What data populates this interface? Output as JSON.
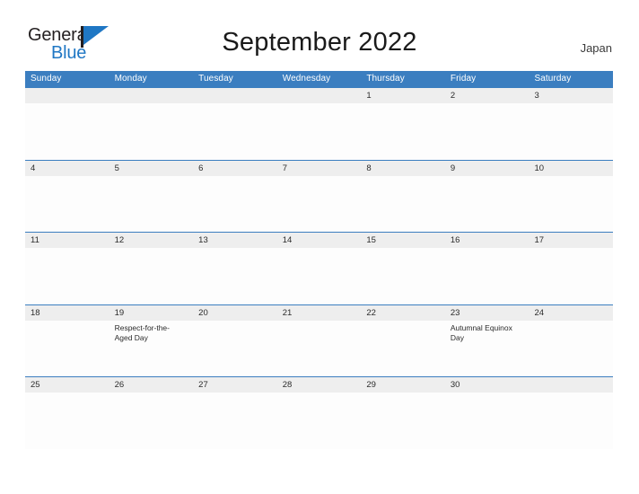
{
  "brand": {
    "name_part1": "General",
    "name_part2": "Blue",
    "flag_icon": "flag-icon",
    "accent_color": "#1f77c4",
    "dark_color": "#231f20"
  },
  "header": {
    "title": "September 2022",
    "region": "Japan"
  },
  "calendar": {
    "header_color": "#3b7ec0",
    "number_strip_color": "#eeeeee",
    "grid_line_color": "#3b7ec0",
    "day_headers": [
      "Sunday",
      "Monday",
      "Tuesday",
      "Wednesday",
      "Thursday",
      "Friday",
      "Saturday"
    ],
    "weeks": [
      {
        "days": [
          {
            "number": "",
            "event": ""
          },
          {
            "number": "",
            "event": ""
          },
          {
            "number": "",
            "event": ""
          },
          {
            "number": "",
            "event": ""
          },
          {
            "number": "1",
            "event": ""
          },
          {
            "number": "2",
            "event": ""
          },
          {
            "number": "3",
            "event": ""
          }
        ]
      },
      {
        "days": [
          {
            "number": "4",
            "event": ""
          },
          {
            "number": "5",
            "event": ""
          },
          {
            "number": "6",
            "event": ""
          },
          {
            "number": "7",
            "event": ""
          },
          {
            "number": "8",
            "event": ""
          },
          {
            "number": "9",
            "event": ""
          },
          {
            "number": "10",
            "event": ""
          }
        ]
      },
      {
        "days": [
          {
            "number": "11",
            "event": ""
          },
          {
            "number": "12",
            "event": ""
          },
          {
            "number": "13",
            "event": ""
          },
          {
            "number": "14",
            "event": ""
          },
          {
            "number": "15",
            "event": ""
          },
          {
            "number": "16",
            "event": ""
          },
          {
            "number": "17",
            "event": ""
          }
        ]
      },
      {
        "days": [
          {
            "number": "18",
            "event": ""
          },
          {
            "number": "19",
            "event": "Respect-for-the-Aged Day"
          },
          {
            "number": "20",
            "event": ""
          },
          {
            "number": "21",
            "event": ""
          },
          {
            "number": "22",
            "event": ""
          },
          {
            "number": "23",
            "event": "Autumnal Equinox Day"
          },
          {
            "number": "24",
            "event": ""
          }
        ]
      },
      {
        "days": [
          {
            "number": "25",
            "event": ""
          },
          {
            "number": "26",
            "event": ""
          },
          {
            "number": "27",
            "event": ""
          },
          {
            "number": "28",
            "event": ""
          },
          {
            "number": "29",
            "event": ""
          },
          {
            "number": "30",
            "event": ""
          },
          {
            "number": "",
            "event": ""
          }
        ]
      }
    ]
  }
}
